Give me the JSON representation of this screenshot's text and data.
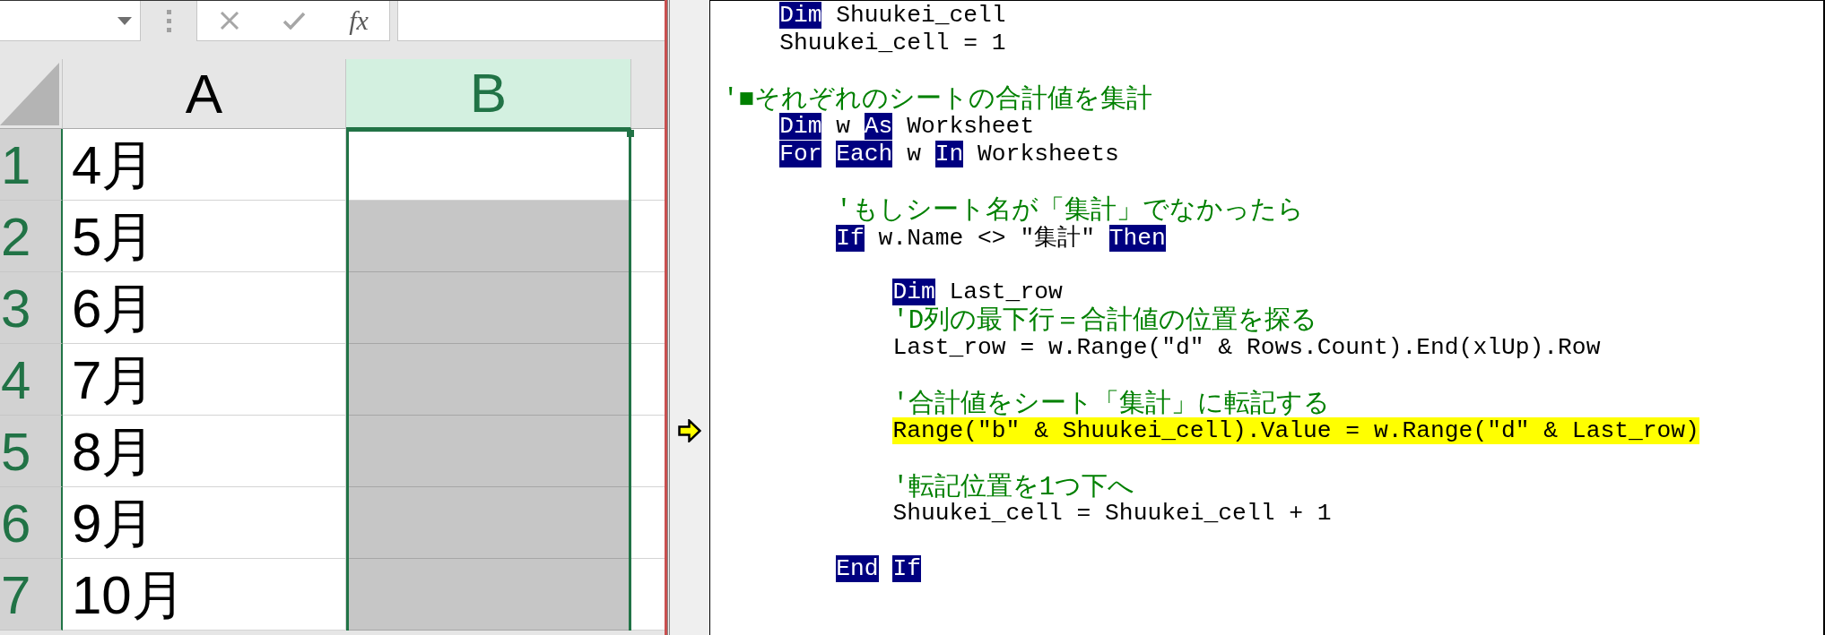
{
  "excel": {
    "formula_bar": {
      "function_button": "fx"
    },
    "columns": [
      {
        "label": "A",
        "selected": false
      },
      {
        "label": "B",
        "selected": true
      }
    ],
    "rows": [
      {
        "number": "1",
        "column_a": "4月",
        "selected": true,
        "active": true
      },
      {
        "number": "2",
        "column_a": "5月",
        "selected": true,
        "active": false
      },
      {
        "number": "3",
        "column_a": "6月",
        "selected": true,
        "active": false
      },
      {
        "number": "4",
        "column_a": "7月",
        "selected": true,
        "active": false
      },
      {
        "number": "5",
        "column_a": "8月",
        "selected": true,
        "active": false
      },
      {
        "number": "6",
        "column_a": "9月",
        "selected": true,
        "active": false
      },
      {
        "number": "7",
        "column_a": "10月",
        "selected": true,
        "active": false
      }
    ]
  },
  "vba_editor": {
    "lines": [
      {
        "kind": "code",
        "current": false,
        "tokens": [
          {
            "kind": "keyword",
            "text": "    Dim"
          },
          {
            "kind": "plain",
            "text": "Shuukei_cell"
          }
        ]
      },
      {
        "kind": "code",
        "current": false,
        "tokens": [
          {
            "kind": "plain",
            "text": "    Shuukei_cell = 1"
          }
        ]
      },
      {
        "kind": "blank",
        "current": false
      },
      {
        "kind": "comment",
        "current": false,
        "text": "'■それぞれのシートの合計値を集計"
      },
      {
        "kind": "code",
        "current": false,
        "tokens": [
          {
            "kind": "keyword",
            "text": "    Dim"
          },
          {
            "kind": "plain",
            "text": "w"
          },
          {
            "kind": "keyword",
            "text": "As"
          },
          {
            "kind": "plain",
            "text": "Worksheet"
          }
        ]
      },
      {
        "kind": "code",
        "current": false,
        "tokens": [
          {
            "kind": "keyword",
            "text": "    For"
          },
          {
            "kind": "keyword",
            "text": "Each"
          },
          {
            "kind": "plain",
            "text": "w"
          },
          {
            "kind": "keyword",
            "text": "In"
          },
          {
            "kind": "plain",
            "text": "Worksheets"
          }
        ]
      },
      {
        "kind": "blank",
        "current": false
      },
      {
        "kind": "comment",
        "current": false,
        "text": "        'もしシート名が「集計」でなかったら"
      },
      {
        "kind": "code",
        "current": false,
        "tokens": [
          {
            "kind": "keyword",
            "text": "        If"
          },
          {
            "kind": "plain",
            "text": "w.Name <> \"集計\""
          },
          {
            "kind": "keyword",
            "text": "Then"
          }
        ]
      },
      {
        "kind": "blank",
        "current": false
      },
      {
        "kind": "code",
        "current": false,
        "tokens": [
          {
            "kind": "keyword",
            "text": "            Dim"
          },
          {
            "kind": "plain",
            "text": "Last_row"
          }
        ]
      },
      {
        "kind": "comment",
        "current": false,
        "text": "            'D列の最下行＝合計値の位置を探る"
      },
      {
        "kind": "code",
        "current": false,
        "tokens": [
          {
            "kind": "plain",
            "text": "            Last_row = w.Range(\"d\" & Rows.Count).End(xlUp).Row"
          }
        ]
      },
      {
        "kind": "blank",
        "current": false
      },
      {
        "kind": "comment",
        "current": false,
        "text": "            '合計値をシート「集計」に転記する"
      },
      {
        "kind": "code",
        "current": true,
        "tokens": [
          {
            "kind": "plain",
            "text": "            Range(\"b\" & Shuukei_cell).Value = w.Range(\"d\" & Last_row)"
          }
        ]
      },
      {
        "kind": "blank",
        "current": false
      },
      {
        "kind": "comment",
        "current": false,
        "text": "            '転記位置を1つ下へ"
      },
      {
        "kind": "code",
        "current": false,
        "tokens": [
          {
            "kind": "plain",
            "text": "            Shuukei_cell = Shuukei_cell + 1"
          }
        ]
      },
      {
        "kind": "blank",
        "current": false
      },
      {
        "kind": "code",
        "current": false,
        "tokens": [
          {
            "kind": "keyword",
            "text": "        End"
          },
          {
            "kind": "keyword",
            "text": "If"
          }
        ]
      }
    ]
  }
}
